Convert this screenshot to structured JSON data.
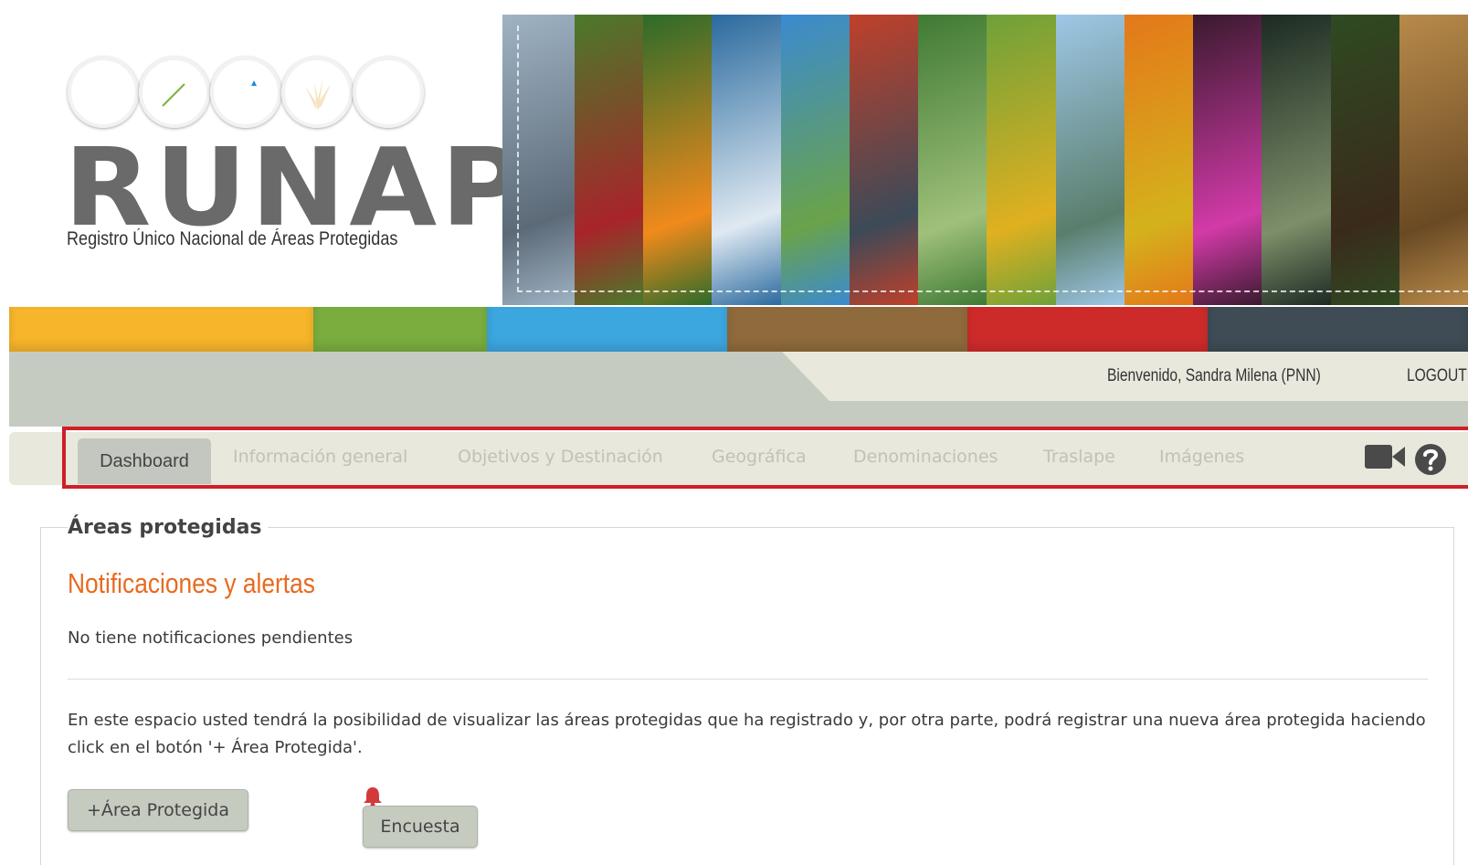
{
  "logo": {
    "wordmark": "RUNAP",
    "subtitle": "Registro Único Nacional de Áreas Protegidas",
    "circle_colors": [
      "#f2a51c",
      "#7cb43c",
      "#1b8fd3",
      "#8a6a3c",
      "#d42a26"
    ],
    "circle_icons": [
      "palm-tree-icon",
      "leaf-icon",
      "mountain-icon",
      "grass-icon",
      "bear-icon"
    ]
  },
  "banner": {
    "photo_strips": [
      {
        "name": "condor-mountain-photo",
        "colors": [
          "#9fb3c4",
          "#5c6a78"
        ]
      },
      {
        "name": "coffee-berries-photo",
        "colors": [
          "#4a7a2a",
          "#a8242a"
        ]
      },
      {
        "name": "flower-butterfly-photo",
        "colors": [
          "#2c6b2a",
          "#f08a1c"
        ]
      },
      {
        "name": "waterfall-sky-photo",
        "colors": [
          "#2a6a9e",
          "#dfe9f2"
        ]
      },
      {
        "name": "palm-beach-photo",
        "colors": [
          "#3b8ad0",
          "#6aa34a"
        ]
      },
      {
        "name": "heliconia-photo",
        "colors": [
          "#c0402a",
          "#3c4a58"
        ]
      },
      {
        "name": "green-valley-photo",
        "colors": [
          "#3f7a34",
          "#9fc07a"
        ]
      },
      {
        "name": "tree-frog-photo",
        "colors": [
          "#6da13a",
          "#e0b020"
        ]
      },
      {
        "name": "sea-coast-photo",
        "colors": [
          "#9ec7e6",
          "#5a7e6c"
        ]
      },
      {
        "name": "macaw-feathers-photo",
        "colors": [
          "#e4781a",
          "#d4b21c"
        ]
      },
      {
        "name": "orchid-photo",
        "colors": [
          "#3a1a2e",
          "#d23aa8"
        ]
      },
      {
        "name": "fish-photo",
        "colors": [
          "#1c2a22",
          "#7d8f6a"
        ]
      },
      {
        "name": "monkey-photo",
        "colors": [
          "#2f4a22",
          "#3a2a1a"
        ]
      },
      {
        "name": "basket-weaving-photo",
        "colors": [
          "#b88a4a",
          "#6a4a24"
        ]
      }
    ]
  },
  "colorbar": [
    {
      "color": "#f6b52a",
      "weight": 333
    },
    {
      "color": "#7aad3e",
      "weight": 190
    },
    {
      "color": "#3ca6df",
      "weight": 263
    },
    {
      "color": "#8f6a3c",
      "weight": 263
    },
    {
      "color": "#cd2b2a",
      "weight": 263
    },
    {
      "color": "#3f4c55",
      "weight": 285
    }
  ],
  "user": {
    "welcome": "Bienvenido, Sandra Milena (PNN)",
    "logout": "LOGOUT"
  },
  "tabs": [
    {
      "label": "Dashboard",
      "active": true
    },
    {
      "label": "Información general",
      "active": false
    },
    {
      "label": "Objetivos y Destinación",
      "active": false
    },
    {
      "label": "Geográfica",
      "active": false
    },
    {
      "label": "Denominaciones",
      "active": false
    },
    {
      "label": "Traslape",
      "active": false
    },
    {
      "label": "Imágenes",
      "active": false
    }
  ],
  "tab_icons": [
    "video-camera-icon",
    "help-icon"
  ],
  "content": {
    "legend": "Áreas protegidas",
    "section_title": "Notificaciones y alertas",
    "no_notifications": "No tiene notificaciones pendientes",
    "description": "En este espacio usted tendrá la posibilidad de visualizar las áreas protegidas que ha registrado y, por otra parte, podrá registrar una nueva área protegida haciendo click en el botón '+ Área Protegida'.",
    "add_button": "+Área Protegida",
    "survey_button": "Encuesta"
  },
  "colors": {
    "accent_orange": "#e86a1f",
    "highlight_red": "#d01f26",
    "tab_inactive": "#c1c1b5",
    "bell_red": "#d23a3a"
  }
}
